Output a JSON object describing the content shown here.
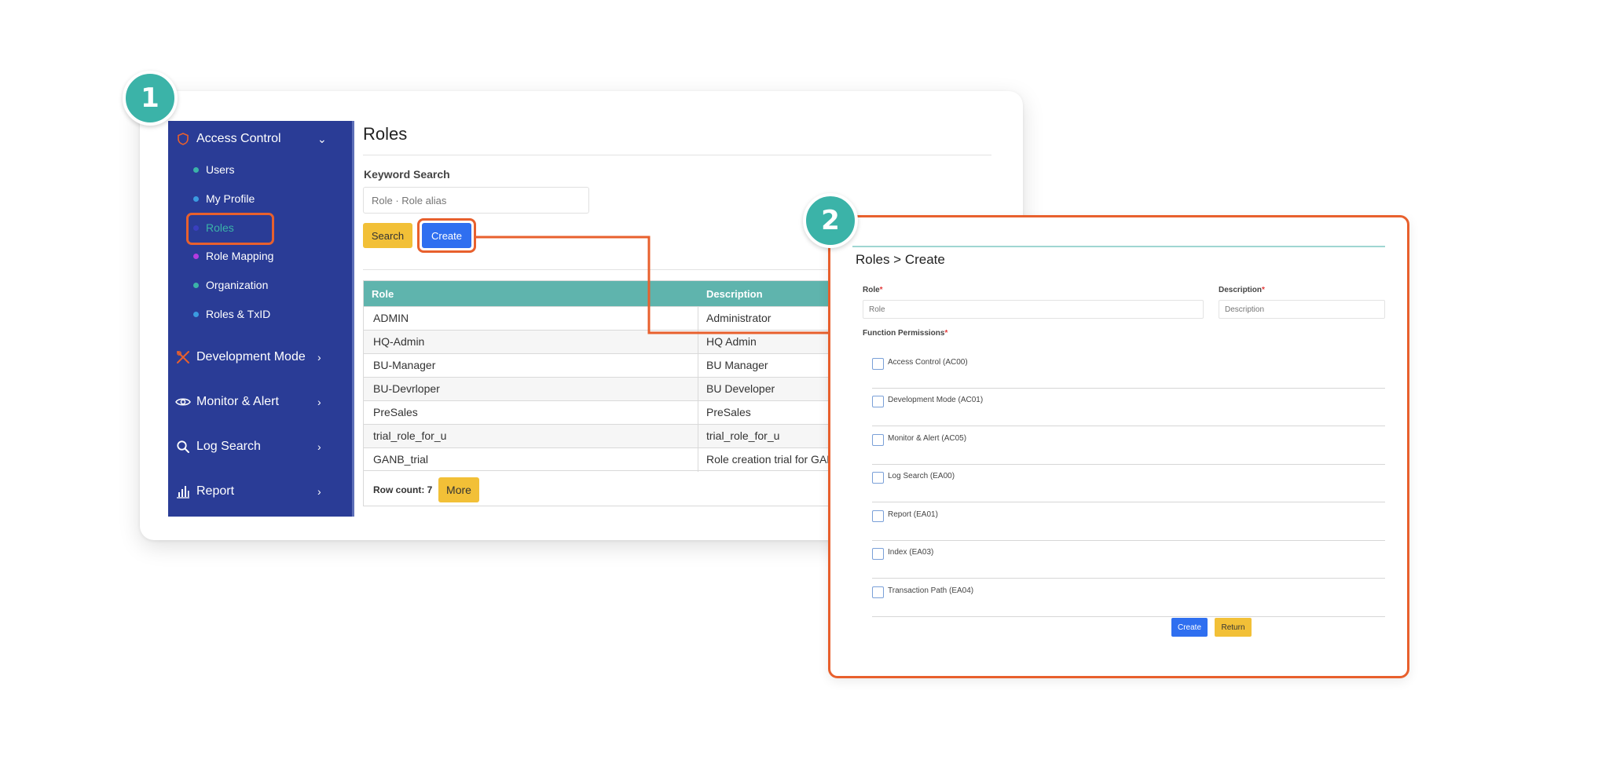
{
  "callouts": {
    "one": "1",
    "two": "2"
  },
  "sidebar": {
    "sections": [
      {
        "label": "Access Control",
        "chevron": "⌄",
        "icon": "shield-icon"
      },
      {
        "label": "Development Mode",
        "chevron": "›",
        "icon": "tools-icon"
      },
      {
        "label": "Monitor & Alert",
        "chevron": "›",
        "icon": "eye-icon"
      },
      {
        "label": "Log Search",
        "chevron": "›",
        "icon": "search-icon"
      },
      {
        "label": "Report",
        "chevron": "›",
        "icon": "bar-chart-icon"
      }
    ],
    "items": [
      {
        "label": "Users",
        "color": "#3bb3a8"
      },
      {
        "label": "My Profile",
        "color": "#3b9be0"
      },
      {
        "label": "Roles",
        "color": "#3a3fbf",
        "active": true,
        "active_color": "#3bb3a8"
      },
      {
        "label": "Role Mapping",
        "color": "#b43be0"
      },
      {
        "label": "Organization",
        "color": "#3bb3a8"
      },
      {
        "label": "Roles & TxID",
        "color": "#3b9be0"
      }
    ]
  },
  "roles_page": {
    "title": "Roles",
    "keyword_label": "Keyword Search",
    "search_placeholder": "Role · Role alias",
    "search_button": "Search",
    "create_button": "Create",
    "table": {
      "columns": [
        "Role",
        "Description"
      ],
      "rows": [
        [
          "ADMIN",
          "Administrator"
        ],
        [
          "HQ-Admin",
          "HQ Admin"
        ],
        [
          "BU-Manager",
          "BU Manager"
        ],
        [
          "BU-Devrloper",
          "BU Developer"
        ],
        [
          "PreSales",
          "PreSales"
        ],
        [
          "trial_role_for_u",
          "trial_role_for_u"
        ],
        [
          "GANB_trial",
          "Role creation trial for GANB"
        ]
      ]
    },
    "row_count": "Row count: 7",
    "more_button": "More"
  },
  "create_form": {
    "breadcrumb": "Roles > Create",
    "role_label": "Role",
    "role_placeholder": "Role",
    "description_label": "Description",
    "description_placeholder": "Description",
    "required_mark": "*",
    "permissions_label": "Function Permissions",
    "permissions": [
      "Access Control (AC00)",
      "Development Mode (AC01)",
      "Monitor & Alert (AC05)",
      "Log Search (EA00)",
      "Report (EA01)",
      "Index (EA03)",
      "Transaction Path (EA04)"
    ],
    "create_button": "Create",
    "return_button": "Return"
  },
  "colors": {
    "sidebar_bg": "#2a3c96",
    "accent_teal": "#3bb3a8",
    "highlight_orange": "#e8602d",
    "primary_blue": "#2f6ff0",
    "warning_yellow": "#f2c037"
  }
}
